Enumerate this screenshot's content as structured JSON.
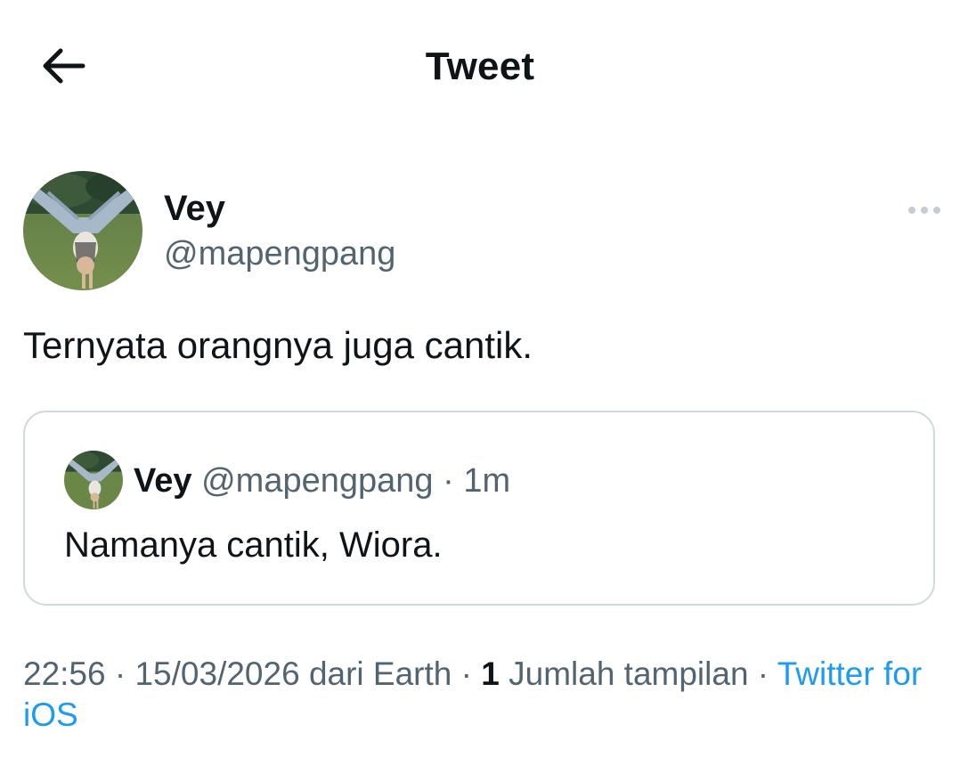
{
  "header": {
    "back_icon": "arrow-left-icon",
    "title": "Tweet"
  },
  "tweet": {
    "author": {
      "name": "Vey",
      "handle": "@mapengpang",
      "avatar": "person-handstand-on-grass-photo"
    },
    "more_icon": "more-horizontal-icon",
    "text": "Ternyata orangnya juga cantik.",
    "quoted": {
      "author_name": "Vey",
      "author_handle": "@mapengpang",
      "separator": " · ",
      "time": "1m",
      "text": "Namanya cantik, Wiora."
    },
    "meta": {
      "time": "22:56",
      "sep1": " · ",
      "date": "15/03/2026",
      "location": " dari Earth",
      "sep2": " · ",
      "views_count": "1",
      "views_label": " Jumlah tampilan",
      "sep3": " · ",
      "source": "Twitter for iOS"
    }
  },
  "colors": {
    "text_primary": "#0f1419",
    "text_secondary": "#536471",
    "link": "#1d9bf0",
    "border": "#cfd9de"
  }
}
